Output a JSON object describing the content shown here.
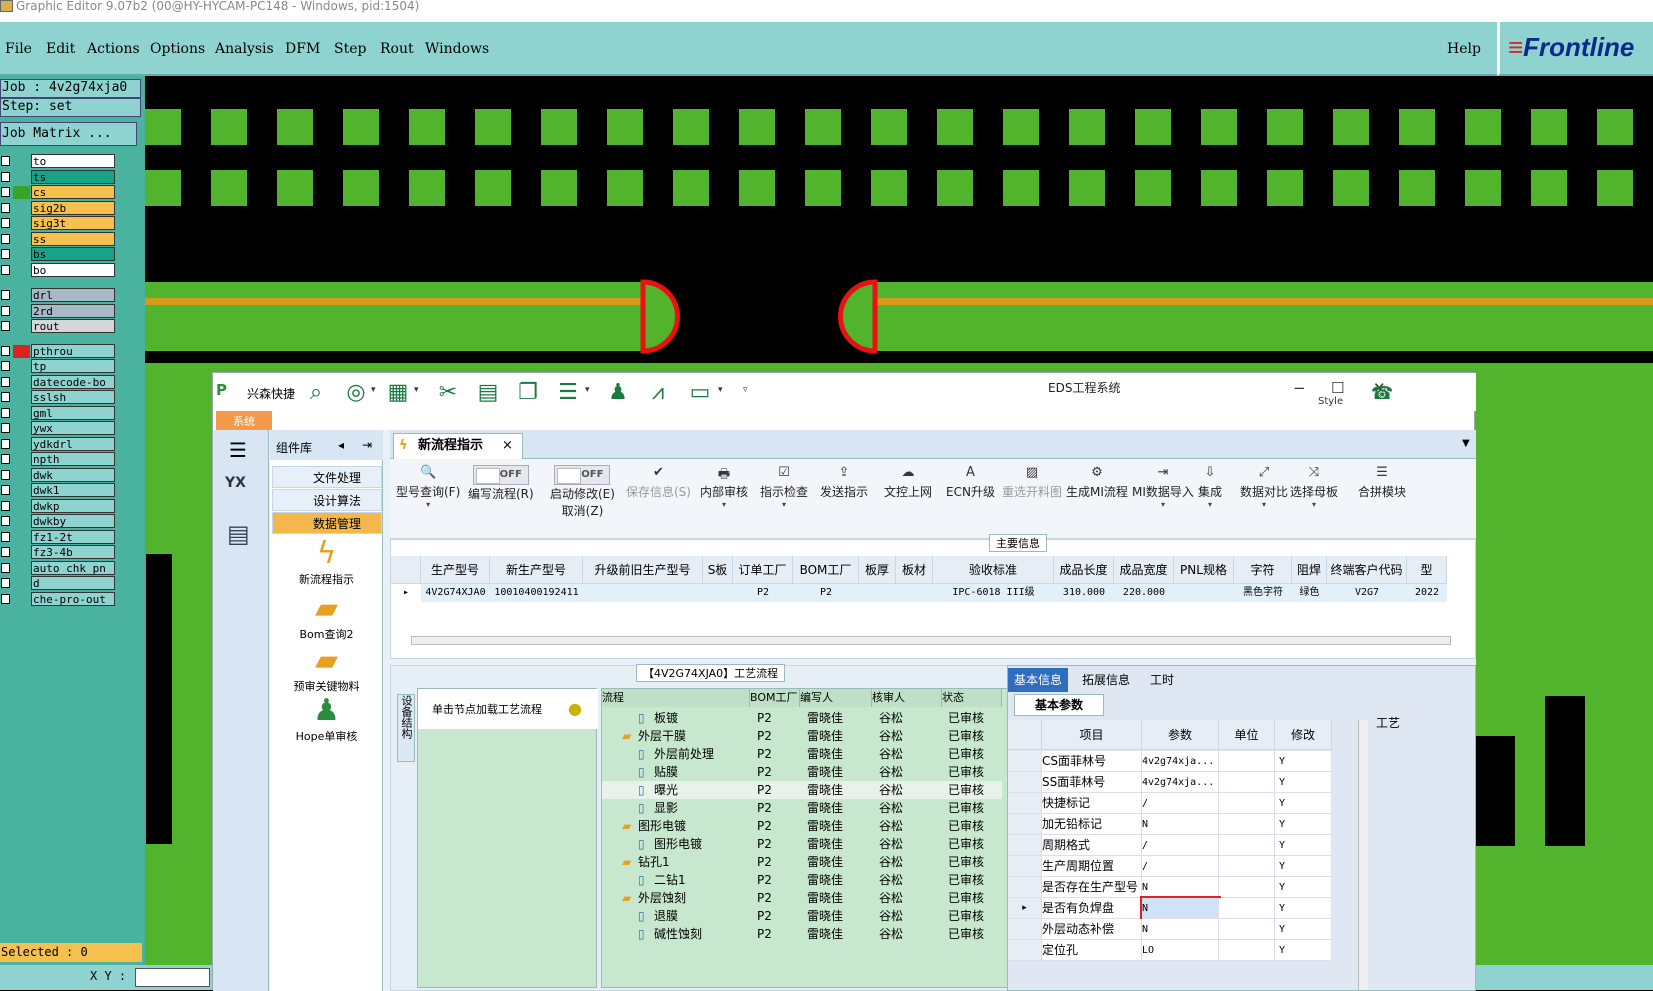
{
  "window_title": "Graphic Editor 9.07b2 (00@HY-HYCAM-PC148 - Windows, pid:1504)",
  "menu": [
    "File",
    "Edit",
    "Actions",
    "Options",
    "Analysis",
    "DFM",
    "Step",
    "Rout",
    "Windows"
  ],
  "help": "Help",
  "brand": "Frontline",
  "job": "Job : 4v2g74xja0",
  "step": "Step: set",
  "job_matrix": "Job Matrix ...",
  "layers": [
    {
      "name": "to",
      "color": "#ffffff"
    },
    {
      "name": "ts",
      "color": "#16a38a"
    },
    {
      "name": "cs",
      "color": "#f6c04e",
      "sw": "#3aa329"
    },
    {
      "name": "sig2b",
      "color": "#f6c04e"
    },
    {
      "name": "sig3t",
      "color": "#f6c04e"
    },
    {
      "name": "ss",
      "color": "#f6c04e"
    },
    {
      "name": "bs",
      "color": "#16a38a"
    },
    {
      "name": "bo",
      "color": "#ffffff"
    },
    {
      "name": "drl",
      "color": "#a8b8c6"
    },
    {
      "name": "2rd",
      "color": "#a8b8c6"
    },
    {
      "name": "rout",
      "color": "#d6d6d6"
    },
    {
      "name": "pthrou",
      "color": "#8ed3cf",
      "sw": "#d22"
    },
    {
      "name": "tp",
      "color": "#8ed3cf"
    },
    {
      "name": "datecode-bo",
      "color": "#8ed3cf"
    },
    {
      "name": "sslsh",
      "color": "#8ed3cf"
    },
    {
      "name": "gml",
      "color": "#8ed3cf"
    },
    {
      "name": "ywx",
      "color": "#8ed3cf"
    },
    {
      "name": "ydkdrl",
      "color": "#8ed3cf"
    },
    {
      "name": "npth",
      "color": "#8ed3cf"
    },
    {
      "name": "dwk",
      "color": "#8ed3cf"
    },
    {
      "name": "dwk1",
      "color": "#8ed3cf"
    },
    {
      "name": "dwkp",
      "color": "#8ed3cf"
    },
    {
      "name": "dwkby",
      "color": "#8ed3cf"
    },
    {
      "name": "fz1-2t",
      "color": "#8ed3cf"
    },
    {
      "name": "fz3-4b",
      "color": "#8ed3cf"
    },
    {
      "name": "auto_chk_pn",
      "color": "#8ed3cf"
    },
    {
      "name": "d",
      "color": "#8ed3cf"
    },
    {
      "name": "che-pro-out",
      "color": "#8ed3cf"
    }
  ],
  "selected": "Selected : 0",
  "xy": "X Y :",
  "eds": {
    "brand": "兴森快捷",
    "title": "EDS工程系统",
    "sys_tab": "系统",
    "style": "Style",
    "component_lib": "组件库",
    "nav": [
      "文件处理",
      "设计算法",
      "数据管理"
    ],
    "tools": [
      "新流程指示",
      "Bom查询2",
      "预审关键物料",
      "Hope单审核"
    ],
    "doc_tab": "新流程指示",
    "ribbon": [
      {
        "label": "型号查询(F)",
        "icon": "🔍",
        "dd": true
      },
      {
        "label": "编写流程(R)",
        "toggle": "OFF"
      },
      {
        "label": "启动修改(E)",
        "label2": "取消(Z)",
        "toggle": "OFF"
      },
      {
        "label": "保存信息(S)",
        "icon": "✔",
        "dis": true
      },
      {
        "label": "内部审核",
        "icon": "🖶",
        "dd": true
      },
      {
        "label": "指示检查",
        "icon": "☑",
        "dd": true
      },
      {
        "label": "发送指示",
        "icon": "⇪"
      },
      {
        "label": "文控上网",
        "icon": "☁"
      },
      {
        "label": "ECN升级",
        "icon": "A"
      },
      {
        "label": "重选开料图",
        "icon": "▨",
        "dis": true
      },
      {
        "label": "生成MI流程",
        "icon": "⚙"
      },
      {
        "label": "MI数据导入",
        "icon": "⇥",
        "dd": true
      },
      {
        "label": "集成",
        "icon": "⇩",
        "dd": true
      },
      {
        "label": "数据对比",
        "icon": "⤢",
        "dd": true
      },
      {
        "label": "选择母板",
        "icon": "⤨",
        "dd": true
      },
      {
        "label": "合拼模块",
        "icon": "☰"
      }
    ],
    "main_info_title": "主要信息",
    "main_headers": [
      "生产型号",
      "新生产型号",
      "升级前旧生产型号",
      "S板",
      "订单工厂",
      "BOM工厂",
      "板厚",
      "板材",
      "验收标准",
      "成品长度",
      "成品宽度",
      "PNL规格",
      "字符",
      "阻焊",
      "终端客户代码",
      "型"
    ],
    "main_row": [
      "4V2G74XJA0",
      "10010400192411",
      "",
      "",
      "P2",
      "P2",
      "",
      "",
      "IPC-6018 III级",
      "310.000",
      "220.000",
      "",
      "黑色字符",
      "绿色",
      "V2G7",
      "2022"
    ],
    "proc_title": "【4V2G74XJA0】工艺流程",
    "proc_vtab": "设备结构",
    "proc_hint": "单击节点加载工艺流程",
    "proc_headers": [
      "流程",
      "BOM工厂",
      "编写人",
      "核审人",
      "状态"
    ],
    "proc_rows": [
      {
        "name": "板镀",
        "lvl": 2,
        "f": "P2",
        "w": "雷晓佳",
        "r": "谷松",
        "s": "已审核"
      },
      {
        "name": "外层干膜",
        "lvl": 1,
        "f": "P2",
        "w": "雷晓佳",
        "r": "谷松",
        "s": "已审核"
      },
      {
        "name": "外层前处理",
        "lvl": 2,
        "f": "P2",
        "w": "雷晓佳",
        "r": "谷松",
        "s": "已审核"
      },
      {
        "name": "贴膜",
        "lvl": 2,
        "f": "P2",
        "w": "雷晓佳",
        "r": "谷松",
        "s": "已审核"
      },
      {
        "name": "曝光",
        "lvl": 2,
        "f": "P2",
        "w": "雷晓佳",
        "r": "谷松",
        "s": "已审核"
      },
      {
        "name": "显影",
        "lvl": 2,
        "f": "P2",
        "w": "雷晓佳",
        "r": "谷松",
        "s": "已审核"
      },
      {
        "name": "图形电镀",
        "lvl": 1,
        "f": "P2",
        "w": "雷晓佳",
        "r": "谷松",
        "s": "已审核"
      },
      {
        "name": "图形电镀",
        "lvl": 2,
        "f": "P2",
        "w": "雷晓佳",
        "r": "谷松",
        "s": "已审核"
      },
      {
        "name": "钻孔1",
        "lvl": 1,
        "f": "P2",
        "w": "雷晓佳",
        "r": "谷松",
        "s": "已审核"
      },
      {
        "name": "二钻1",
        "lvl": 2,
        "f": "P2",
        "w": "雷晓佳",
        "r": "谷松",
        "s": "已审核"
      },
      {
        "name": "外层蚀刻",
        "lvl": 1,
        "f": "P2",
        "w": "雷晓佳",
        "r": "谷松",
        "s": "已审核"
      },
      {
        "name": "退膜",
        "lvl": 2,
        "f": "P2",
        "w": "雷晓佳",
        "r": "谷松",
        "s": "已审核"
      },
      {
        "name": "碱性蚀刻",
        "lvl": 2,
        "f": "P2",
        "w": "雷晓佳",
        "r": "谷松",
        "s": "已审核"
      }
    ],
    "right_tabs": [
      "基本信息",
      "拓展信息",
      "工时"
    ],
    "right_sub": "基本参数",
    "right_side": "工艺",
    "right_headers": [
      "项目",
      "参数",
      "单位",
      "修改"
    ],
    "right_rows": [
      {
        "k": "CS面菲林号",
        "v": "4v2g74xja...",
        "m": "Y"
      },
      {
        "k": "SS面菲林号",
        "v": "4v2g74xja...",
        "m": "Y"
      },
      {
        "k": "快捷标记",
        "v": "/",
        "m": "Y"
      },
      {
        "k": "加无铅标记",
        "v": "N",
        "m": "Y"
      },
      {
        "k": "周期格式",
        "v": "/",
        "m": "Y"
      },
      {
        "k": "生产周期位置",
        "v": "/",
        "m": "Y"
      },
      {
        "k": "是否存在生产型号",
        "v": "N",
        "m": "Y"
      },
      {
        "k": "是否有负焊盘",
        "v": "N",
        "m": "Y",
        "sel": true
      },
      {
        "k": "外层动态补偿",
        "v": "N",
        "m": "Y"
      },
      {
        "k": "定位孔",
        "v": "LO",
        "m": "Y"
      }
    ]
  }
}
